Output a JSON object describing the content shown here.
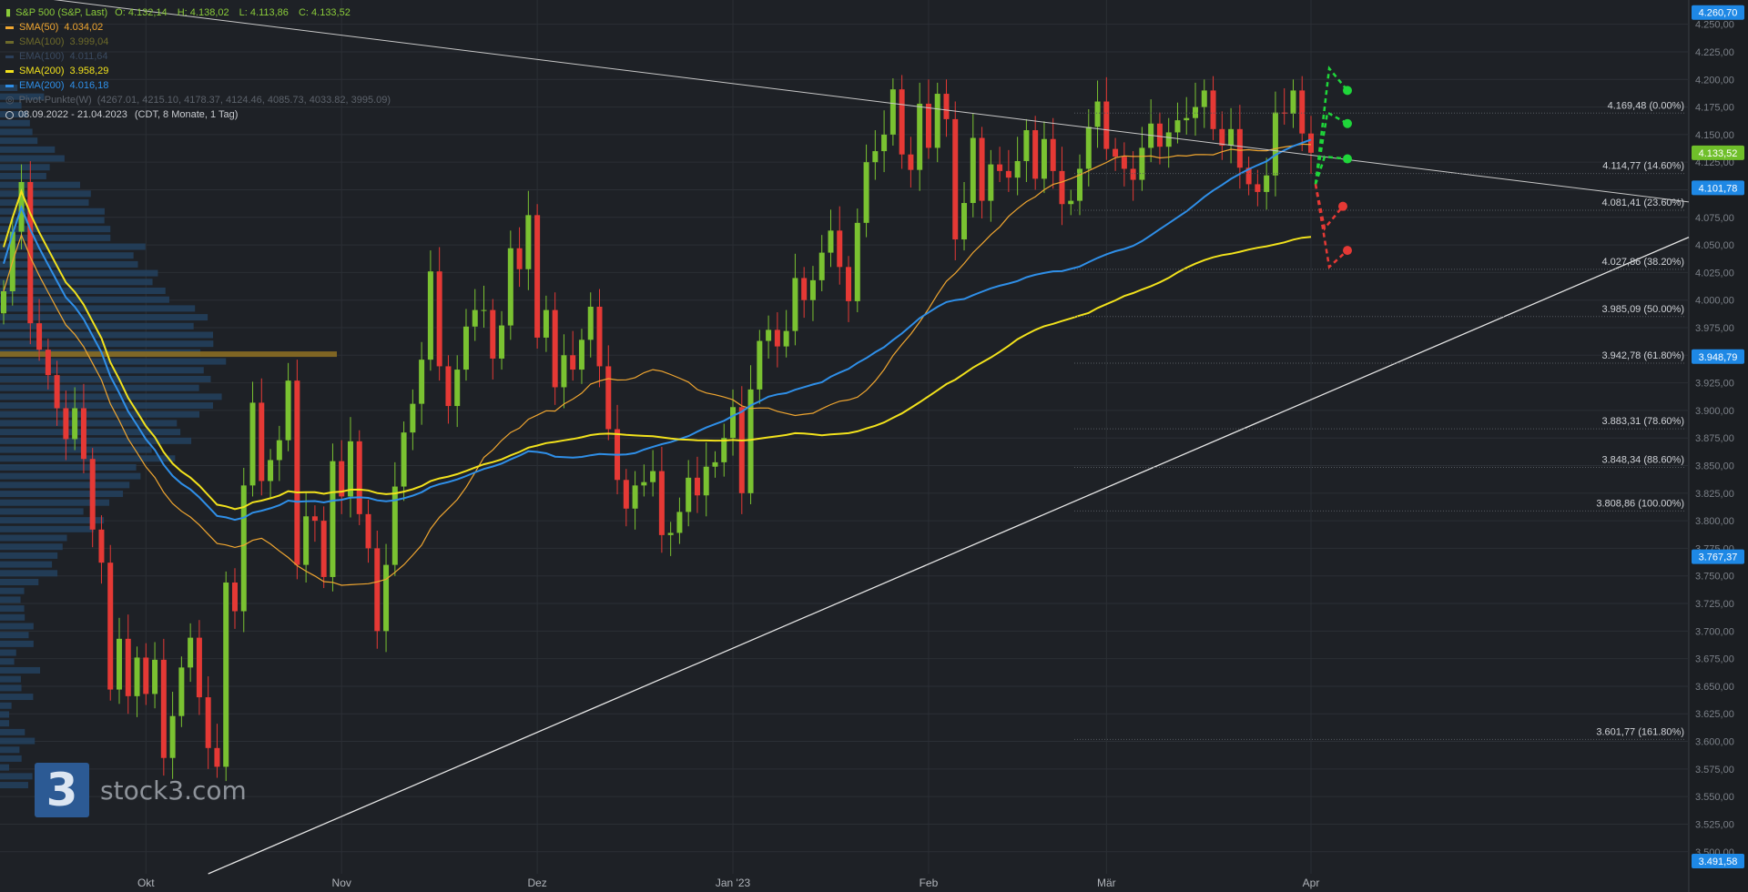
{
  "legend": {
    "instrument": "S&P 500 (S&P, Last)",
    "ohlc": {
      "o": "O: 4.132,14",
      "h": "H: 4.138,02",
      "l": "L: 4.113,86",
      "c": "C: 4.133,52"
    },
    "indicators": [
      {
        "name": "SMA(50)",
        "value": "4.034,02",
        "color": "#f0a630",
        "dim": false
      },
      {
        "name": "SMA(100)",
        "value": "3.999,04",
        "color": "#6d6a2a",
        "dim": true
      },
      {
        "name": "EMA(100)",
        "value": "4.011,64",
        "color": "#2b3f5a",
        "dim": true
      },
      {
        "name": "SMA(200)",
        "value": "3.958,29",
        "color": "#f2e21c",
        "dim": false
      },
      {
        "name": "EMA(200)",
        "value": "4.016,18",
        "color": "#2f8fe8",
        "dim": false
      }
    ],
    "pivot": {
      "name": "Pivot-Punkte(W)",
      "values": "(4267.01, 4215.10, 4178.37, 4124.46, 4085.73, 4033.82, 3995.09)"
    },
    "range": "08.09.2022 - 21.04.2023",
    "period": "(CDT, 8 Monate, 1 Tag)"
  },
  "logo": {
    "mark": "3",
    "text": "stock3.com"
  },
  "chart_data": {
    "type": "candlestick",
    "title": "S&P 500 (S&P, Last)",
    "ylim": [
      3480,
      4272
    ],
    "y_ticks": [
      "3.500,00",
      "3.525,00",
      "3.550,00",
      "3.575,00",
      "3.600,00",
      "3.625,00",
      "3.650,00",
      "3.675,00",
      "3.700,00",
      "3.725,00",
      "3.750,00",
      "3.775,00",
      "3.800,00",
      "3.825,00",
      "3.850,00",
      "3.875,00",
      "3.900,00",
      "3.925,00",
      "3.950,00",
      "3.975,00",
      "4.000,00",
      "4.025,00",
      "4.050,00",
      "4.075,00",
      "4.100,00",
      "4.125,00",
      "4.150,00",
      "4.175,00",
      "4.200,00",
      "4.225,00",
      "4.250,00"
    ],
    "y_tick_values": [
      3500,
      3525,
      3550,
      3575,
      3600,
      3625,
      3650,
      3675,
      3700,
      3725,
      3750,
      3775,
      3800,
      3825,
      3850,
      3875,
      3900,
      3925,
      3950,
      3975,
      4000,
      4025,
      4050,
      4075,
      4100,
      4125,
      4150,
      4175,
      4200,
      4225,
      4250
    ],
    "x_ticks": [
      {
        "label": "Okt",
        "index": 16
      },
      {
        "label": "Nov",
        "index": 38
      },
      {
        "label": "Dez",
        "index": 60
      },
      {
        "label": "Jan '23",
        "index": 82
      },
      {
        "label": "Feb",
        "index": 104
      },
      {
        "label": "Mär",
        "index": 124
      },
      {
        "label": "Apr",
        "index": 147
      }
    ],
    "price_tags": [
      {
        "label": "4.260,70",
        "value": 4260.7,
        "color": "#1e88e5"
      },
      {
        "label": "4.133,52",
        "value": 4133.52,
        "color": "#6fbf2a"
      },
      {
        "label": "4.101,78",
        "value": 4101.78,
        "color": "#1e88e5"
      },
      {
        "label": "3.948,79",
        "value": 3948.79,
        "color": "#1e88e5"
      },
      {
        "label": "3.767,37",
        "value": 3767.37,
        "color": "#1e88e5"
      },
      {
        "label": "3.491,58",
        "value": 3491.58,
        "color": "#1e88e5"
      }
    ],
    "fib_levels": [
      {
        "label": "4.169,48 (0.00%)",
        "value": 4169.48
      },
      {
        "label": "4.114,77 (14.60%)",
        "value": 4114.77
      },
      {
        "label": "4.081,41 (23.60%)",
        "value": 4081.41
      },
      {
        "label": "4.027,86 (38.20%)",
        "value": 4027.86
      },
      {
        "label": "3.985,09 (50.00%)",
        "value": 3985.09
      },
      {
        "label": "3.942,78 (61.80%)",
        "value": 3942.78
      },
      {
        "label": "3.883,31 (78.60%)",
        "value": 3883.31
      },
      {
        "label": "3.848,34 (88.60%)",
        "value": 3848.34
      },
      {
        "label": "3.808,86 (100.00%)",
        "value": 3808.86
      },
      {
        "label": "3.601,77 (161.80%)",
        "value": 3601.77
      }
    ],
    "closes": [
      4008,
      4062,
      4107,
      3979,
      3955,
      3932,
      3902,
      3874,
      3902,
      3856,
      3792,
      3762,
      3647,
      3693,
      3641,
      3676,
      3643,
      3674,
      3585,
      3623,
      3667,
      3694,
      3640,
      3594,
      3577,
      3744,
      3718,
      3832,
      3907,
      3836,
      3855,
      3873,
      3927,
      3760,
      3804,
      3800,
      3749,
      3854,
      3822,
      3872,
      3806,
      3775,
      3700,
      3760,
      3831,
      3880,
      3906,
      3946,
      4026,
      3940,
      3904,
      3937,
      3976,
      3991,
      3991,
      3947,
      3977,
      4047,
      4028,
      4077,
      3966,
      3991,
      3921,
      3950,
      3937,
      3964,
      3994,
      3940,
      3883,
      3837,
      3811,
      3832,
      3835,
      3845,
      3787,
      3789,
      3808,
      3839,
      3823,
      3849,
      3853,
      3875,
      3903,
      3825,
      3919,
      3963,
      3973,
      3958,
      3972,
      4020,
      4000,
      4018,
      4043,
      4063,
      4030,
      3999,
      4070,
      4125,
      4135,
      4150,
      4191,
      4132,
      4118,
      4178,
      4138,
      4187,
      4164,
      4055,
      4088,
      4147,
      4090,
      4123,
      4117,
      4111,
      4126,
      4154,
      4110,
      4146,
      4117,
      4087,
      4090,
      4119,
      4157,
      4180,
      4137,
      4130,
      4119,
      4109,
      4138,
      4160,
      4139,
      4152,
      4163,
      4165,
      4175,
      4190,
      4155,
      4140,
      4155,
      4120,
      4105,
      4098,
      4113,
      4170,
      4169,
      4190,
      4151,
      4133.52
    ],
    "ema200_range": "3.948,79",
    "ema200_values": [
      4015,
      3992,
      3990,
      3993,
      3994,
      3995,
      3994,
      3993,
      3991,
      3990
    ],
    "sma50_values": [
      4034.02
    ],
    "sma200_values": [
      3958.29
    ],
    "annotations": [
      "wedge upper trendline",
      "wedge lower trendline",
      "bullish scenario arrows",
      "bearish scenario arrows"
    ]
  }
}
